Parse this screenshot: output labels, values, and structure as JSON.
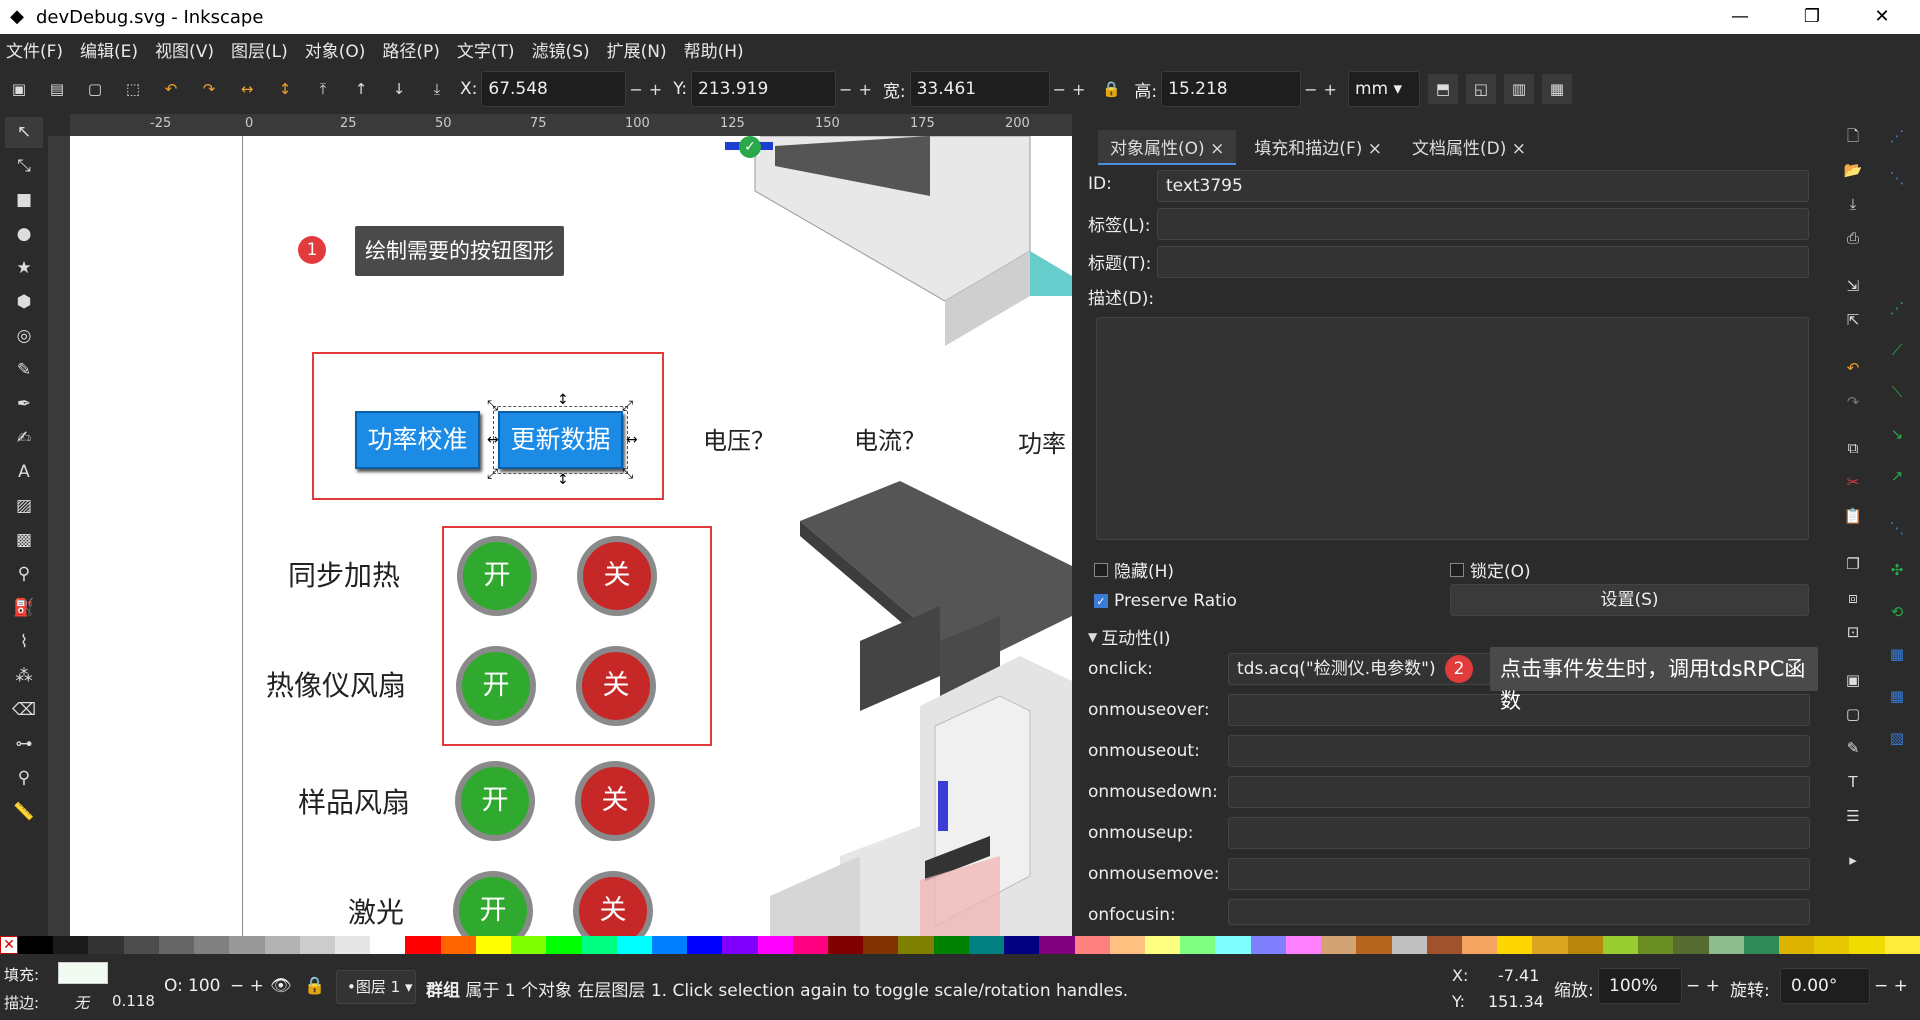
{
  "window": {
    "title": "devDebug.svg - Inkscape",
    "icon": "inkscape-icon",
    "minimize": "—",
    "maximize": "❐",
    "close": "✕"
  },
  "menu": [
    "文件(F)",
    "编辑(E)",
    "视图(V)",
    "图层(L)",
    "对象(O)",
    "路径(P)",
    "文字(T)",
    "滤镜(S)",
    "扩展(N)",
    "帮助(H)"
  ],
  "toolbar": {
    "x_label": "X:",
    "x_value": "67.548",
    "y_label": "Y:",
    "y_value": "213.919",
    "w_label": "宽:",
    "w_value": "33.461",
    "h_label": "高:",
    "h_value": "15.218",
    "unit": "mm",
    "minus": "−",
    "plus": "+"
  },
  "ruler": {
    "h_ticks": [
      "-25",
      "0",
      "25",
      "50",
      "75",
      "100",
      "125",
      "150",
      "175",
      "200"
    ]
  },
  "canvas": {
    "tip1_num": "1",
    "tip1_text": "绘制需要的按钮图形",
    "btn1": "功率校准",
    "btn2": "更新数据",
    "voltage": "电压？",
    "current": "电流？",
    "power": "功率",
    "rows": [
      {
        "label": "同步加热",
        "on": "开",
        "off": "关"
      },
      {
        "label": "热像仪风扇",
        "on": "开",
        "off": "关"
      },
      {
        "label": "样品风扇",
        "on": "开",
        "off": "关"
      },
      {
        "label": "激光",
        "on": "开",
        "off": "关"
      }
    ]
  },
  "panel": {
    "tabs": [
      "对象属性(O)",
      "填充和描边(F)",
      "文档属性(D)"
    ],
    "tab_close": "×",
    "id_label": "ID:",
    "id_value": "text3795",
    "label_label": "标签(L):",
    "title_label": "标题(T):",
    "desc_label": "描述(D):",
    "hide_label": "隐藏(H)",
    "lock_label": "锁定(O)",
    "preserve_label": "Preserve Ratio",
    "set_button": "设置(S)",
    "interactivity_label": "互动性(I)",
    "events": [
      {
        "name": "onclick:",
        "value": "tds.acq(\"检测仪.电参数\")"
      },
      {
        "name": "onmouseover:",
        "value": ""
      },
      {
        "name": "onmouseout:",
        "value": ""
      },
      {
        "name": "onmousedown:",
        "value": ""
      },
      {
        "name": "onmouseup:",
        "value": ""
      },
      {
        "name": "onmousemove:",
        "value": ""
      },
      {
        "name": "onfocusin:",
        "value": ""
      }
    ],
    "tip2_num": "2",
    "tip2_text": "点击事件发生时，调用tdsRPC函数"
  },
  "status": {
    "fill_label": "填充:",
    "stroke_label": "描边:",
    "stroke_value": "无",
    "stroke_width": "0.118",
    "opacity_label": "O:",
    "opacity_value": "100",
    "layer": "•图层 1",
    "message_bold": "群组",
    "message": "属于 1 个对象 在层图层 1. Click selection again to toggle scale/rotation handles.",
    "x_label": "X:",
    "x_value": "-7.41",
    "y_label": "Y:",
    "y_value": "151.34",
    "zoom_label": "缩放:",
    "zoom_value": "100%",
    "rot_label": "旋转:",
    "rot_value": "0.00°"
  },
  "palette": [
    "#000000",
    "#1a1a1a",
    "#333333",
    "#4d4d4d",
    "#666666",
    "#808080",
    "#999999",
    "#b3b3b3",
    "#cccccc",
    "#e6e6e6",
    "#ffffff",
    "#ff0000",
    "#ff6600",
    "#ffff00",
    "#80ff00",
    "#00ff00",
    "#00ff80",
    "#00ffff",
    "#0080ff",
    "#0000ff",
    "#8000ff",
    "#ff00ff",
    "#ff0080",
    "#800000",
    "#803300",
    "#808000",
    "#008000",
    "#008080",
    "#000080",
    "#800080",
    "#ff8080",
    "#ffc080",
    "#ffff80",
    "#80ff80",
    "#80ffff",
    "#8080ff",
    "#ff80ff",
    "#d4a373",
    "#b5651d",
    "#c0c0c0",
    "#a0522d",
    "#f4a460",
    "#ffd700",
    "#daa520",
    "#b8860b",
    "#9acd32",
    "#6b8e23",
    "#556b2f",
    "#8fbc8f",
    "#2e8b57",
    "#dcb400",
    "#e6c800",
    "#f0dc00",
    "#ffeb3b"
  ]
}
